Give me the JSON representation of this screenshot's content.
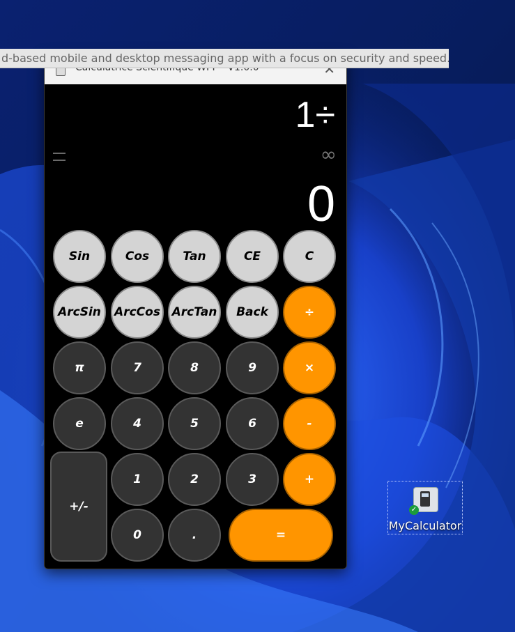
{
  "tooltip": "d-based mobile and desktop messaging app with a focus on security and speed.",
  "window": {
    "title": "Calculatrice Scientifique WPF - V1.0.0",
    "close": "✕"
  },
  "display": {
    "expression": "1÷",
    "status": "∞",
    "result": "0"
  },
  "buttons": {
    "sin": "Sin",
    "cos": "Cos",
    "tan": "Tan",
    "ce": "CE",
    "c": "C",
    "arcsin": "ArcSin",
    "arccos": "ArcCos",
    "arctan": "ArcTan",
    "back": "Back",
    "divide": "÷",
    "pi": "π",
    "seven": "7",
    "eight": "8",
    "nine": "9",
    "multiply": "×",
    "e": "e",
    "four": "4",
    "five": "5",
    "six": "6",
    "minus": "-",
    "negate": "+/-",
    "one": "1",
    "two": "2",
    "three": "3",
    "plus": "+",
    "zero": "0",
    "dot": ".",
    "equals": "="
  },
  "desktop": {
    "icon_label": "MyCalculator"
  },
  "colors": {
    "orange": "#ff9500",
    "light": "#d4d4d4",
    "dark": "#333333"
  }
}
